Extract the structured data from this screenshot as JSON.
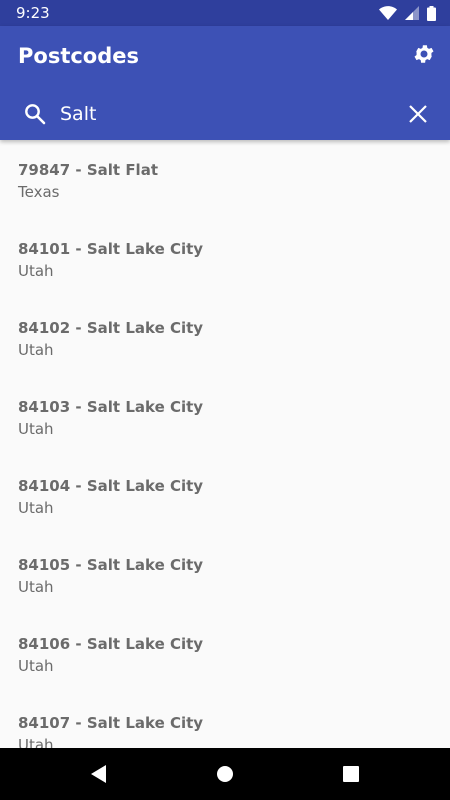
{
  "status_bar": {
    "time": "9:23"
  },
  "app_bar": {
    "title": "Postcodes"
  },
  "search": {
    "value": "Salt"
  },
  "results": [
    {
      "title": "79847 - Salt Flat",
      "subtitle": "Texas"
    },
    {
      "title": "84101 - Salt Lake City",
      "subtitle": "Utah"
    },
    {
      "title": "84102 - Salt Lake City",
      "subtitle": "Utah"
    },
    {
      "title": "84103 - Salt Lake City",
      "subtitle": "Utah"
    },
    {
      "title": "84104 - Salt Lake City",
      "subtitle": "Utah"
    },
    {
      "title": "84105 - Salt Lake City",
      "subtitle": "Utah"
    },
    {
      "title": "84106 - Salt Lake City",
      "subtitle": "Utah"
    },
    {
      "title": "84107 - Salt Lake City",
      "subtitle": "Utah"
    }
  ],
  "colors": {
    "primary": "#3d51b5",
    "primary_dark": "#2f3f9d",
    "text": "#6b6b6b"
  },
  "icons": [
    "wifi-icon",
    "cell-signal-icon",
    "battery-icon",
    "gear-icon",
    "search-icon",
    "close-icon",
    "back-icon",
    "home-icon",
    "recents-icon"
  ]
}
